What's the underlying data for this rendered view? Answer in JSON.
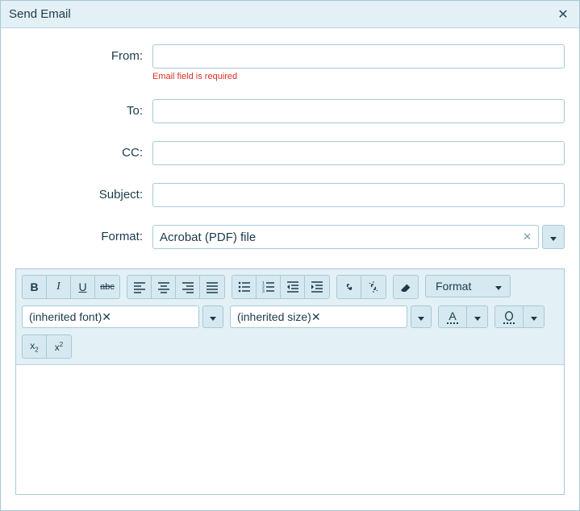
{
  "window": {
    "title": "Send Email"
  },
  "form": {
    "from": {
      "label": "From:",
      "value": "",
      "error": "Email field is required"
    },
    "to": {
      "label": "To:",
      "value": ""
    },
    "cc": {
      "label": "CC:",
      "value": ""
    },
    "subject": {
      "label": "Subject:",
      "value": ""
    },
    "format": {
      "label": "Format:",
      "value": "Acrobat (PDF) file"
    }
  },
  "toolbar": {
    "format_dropdown": "Format",
    "font_combo": "(inherited font)",
    "size_combo": "(inherited size)"
  }
}
